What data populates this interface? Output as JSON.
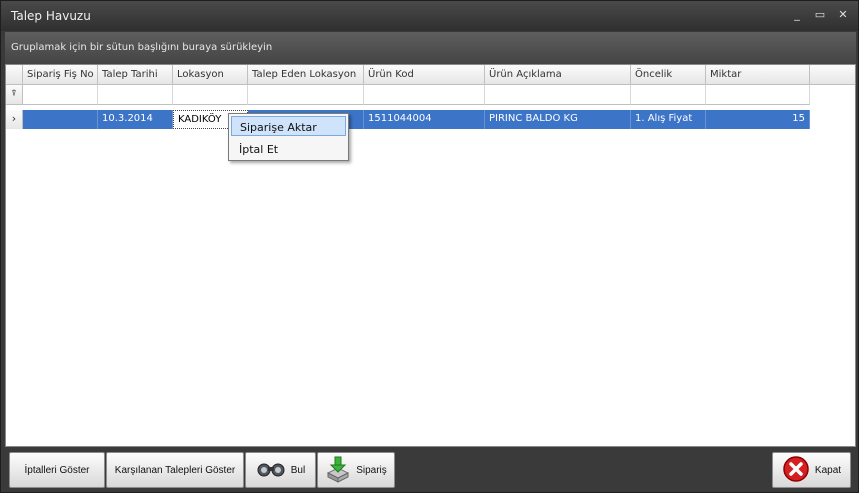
{
  "window": {
    "title": "Talep Havuzu"
  },
  "group_panel_text": "Gruplamak için bir sütun başlığını buraya sürükleyin",
  "columns": [
    "Sipariş Fiş No",
    "Talep Tarihi",
    "Lokasyon",
    "Talep Eden Lokasyon",
    "Ürün Kod",
    "Ürün Açıklama",
    "Öncelik",
    "Miktar"
  ],
  "row": {
    "siparis_fis_no": "",
    "talep_tarihi": "10.3.2014",
    "lokasyon": "KADIKÖY",
    "talep_eden_lokasyon": "",
    "urun_kod": "1511044004",
    "urun_aciklama": "PIRINC BALDO KG",
    "oncelik": "1. Alış Fiyat",
    "miktar": "15"
  },
  "context_menu": [
    "Siparişe Aktar",
    "İptal Et"
  ],
  "toolbar": {
    "iptalleri_goster": "İptalleri Göster",
    "karsilanan": "Karşılanan Talepleri Göster",
    "bul": "Bul",
    "siparis": "Sipariş",
    "kapat": "Kapat"
  },
  "icons": {
    "filter": "filter-icon",
    "row_pointer": "row-pointer-icon",
    "binoculars": "binoculars-icon",
    "order": "order-icon",
    "close": "close-icon"
  }
}
